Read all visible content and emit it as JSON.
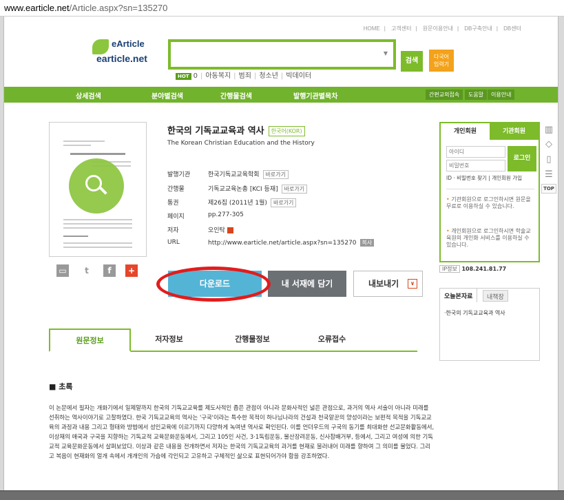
{
  "url": {
    "host": "www.earticle.net",
    "path": "/Article.aspx?sn=135270"
  },
  "top_links": [
    "HOME",
    "고객센터",
    "원문이용안내",
    "DB구축안내",
    "DB센터"
  ],
  "logo": {
    "line1": "eArticle",
    "line2": "earticle.net"
  },
  "search": {
    "placeholder": "",
    "button": "검색",
    "lang_button_line1": "다국어",
    "lang_button_line2": "입력기"
  },
  "hot": {
    "badge": "HOT",
    "count": "0",
    "terms": [
      "아동복지",
      "범죄",
      "청소년",
      "빅데이터"
    ]
  },
  "gnb": {
    "items": [
      "상세검색",
      "분야별검색",
      "간행물검색",
      "발행기관별목차"
    ],
    "utils": [
      "간편교외접속",
      "도움말",
      "이용안내"
    ]
  },
  "article": {
    "title": "한국의 기독교교육과 역사",
    "lang_badge": "한국어(KOR)",
    "subtitle": "The Korean Christian Education and the History",
    "meta": [
      {
        "label": "발행기관",
        "value": "한국기독교교육학회",
        "action": "바로가기"
      },
      {
        "label": "간행물",
        "value": "기독교교육논총 [KCI 등재]",
        "action": "바로가기"
      },
      {
        "label": "통권",
        "value": "제26집 (2011년 1월)",
        "action": "바로가기"
      },
      {
        "label": "페이지",
        "value": "pp.277-305",
        "action": ""
      },
      {
        "label": "저자",
        "value": "오인탁",
        "action": ""
      },
      {
        "label": "URL",
        "value": "http://www.earticle.net/article.aspx?sn=135270",
        "action": "복사"
      }
    ]
  },
  "actions": {
    "download": "다운로드",
    "shelf": "내 서재에 담기",
    "export": "내보내기"
  },
  "tabs": [
    "원문정보",
    "저자정보",
    "간행물정보",
    "오류접수"
  ],
  "abstract": {
    "heading": "■ 초록",
    "text": "이 논문에서 필자는 개화기에서 일제말까지 한국의 기독교교육를 제도사적인 좁은 관점이 아니라 문화사적인 넓은 관점으로, 과거의 역사 서술이 아니라 미래를 선취하는 역사이야기로 고찰하였다. 한국 기독교교육의 역사는 '구국'이라는 특수한 목적이 하나님나라의 건설과 천국알꾼의 양성이라는 보편적 목적을 기독교교육의 과정과 내용 그리고 형태와 방법에서 성인교육에 이르기까지 다양하게 녹여낸 역사로 확인된다. 이를 언더우드의 구국의 동기를 최대화한 선교문화활동에서, 이상재의 애국과 구국을 지향하는 기독교적 교육문화운동에서, 그리고 105인 사건, 3·1독립운동, 물산장려운동, 신사참배거부, 등에서, 그리고 여성에 의한 기독교적 교육문화운동에서 살펴보았다. 이상과 같은 내용을 전개하면서 저자는 한국의 기독교교육의 과거를 현재로 불러내어 미래를 향하여 그 의미를 물었다. 그리고 복음이 현재화의 얼개 속에서 개개인의 가슴에 각인되고 고유하고 구체적인 삶으로 표현되어가야 함을 강조하였다."
  },
  "login": {
    "tab_personal": "개인회원",
    "tab_institution": "기관회원",
    "id_placeholder": "아이디",
    "pw_placeholder": "비밀번호",
    "button": "로그인",
    "find": "ID · 비밀번호 찾기",
    "join": "개인회원 가입",
    "note1": "기관회원으로 로그인하시면 원문을 무료로 이용하실 수 있습니다.",
    "note2": "개인회원으로 로그인하시면 학술교육원의 개인화 서비스를 이용하실 수 있습니다."
  },
  "ip": {
    "label": "IP정보",
    "value": "108.241.81.77"
  },
  "today": {
    "tab_a": "오늘본자료",
    "tab_b": "내책장",
    "items": [
      "·한국의 기독교교육과 역사"
    ]
  },
  "quick_menu": {
    "top": "TOP"
  }
}
